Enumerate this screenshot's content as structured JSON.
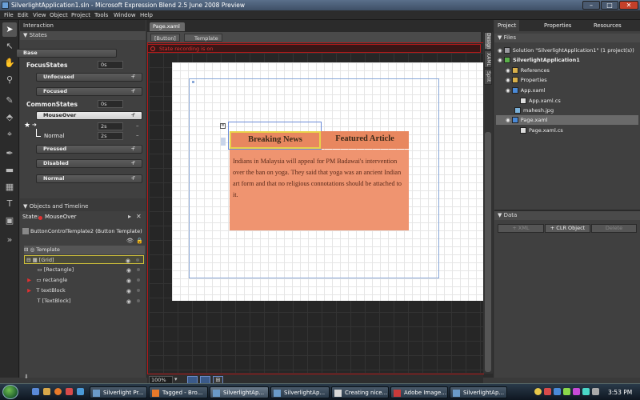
{
  "window": {
    "title": "SilverlightApplication1.sln - Microsoft Expression Blend 2.5 June 2008 Preview",
    "minimize": "–",
    "maximize": "□",
    "close": "✕"
  },
  "menu": [
    "File",
    "Edit",
    "View",
    "Object",
    "Project",
    "Tools",
    "Window",
    "Help"
  ],
  "interaction": {
    "title": "Interaction",
    "states_header": "States",
    "base_label": "Base",
    "focus_group": "FocusStates",
    "focus_time": "0s",
    "unfocused": "Unfocused",
    "focused": "Focused",
    "common_group": "CommonStates",
    "common_time": "0s",
    "mouseover": "MouseOver",
    "transition_time_1": "2s",
    "normal_transition": "Normal",
    "transition_time_2": "2s",
    "star": "★",
    "pressed": "Pressed",
    "disabled": "Disabled",
    "normal": "Normal"
  },
  "objects": {
    "title": "Objects and Timeline",
    "state_label": "State:",
    "state_value": "MouseOver",
    "template_name": "ButtonControlTemplate2 (Button Template)",
    "template": "Template",
    "layers": [
      "[Grid]",
      "[Rectangle]",
      "rectangle",
      "textBlock",
      "[TextBlock]"
    ]
  },
  "document": {
    "tab": "Page.xaml",
    "crumb_button": "[Button]",
    "crumb_template": "Template",
    "recording": "State recording is on",
    "vtabs": [
      "Design",
      "XAML",
      "Split"
    ],
    "zoom": "100%"
  },
  "artboard": {
    "tab1": "Breaking News",
    "tab2": "Featured Article",
    "article": "Indians in Malaysia will appeal for PM Badawai's intervention over the ban on yoga. They said that yoga was an ancient Indian art form and that no religious connotations should be attached to it."
  },
  "project": {
    "tabs": [
      "Project",
      "Properties",
      "Resources"
    ],
    "files_header": "Files",
    "tree": [
      "Solution \"SilverlightApplication1\" (1 project(s))",
      "SilverlightApplication1",
      "References",
      "Properties",
      "App.xaml",
      "App.xaml.cs",
      "mahesh.jpg",
      "Page.xaml",
      "Page.xaml.cs"
    ]
  },
  "data": {
    "title": "Data",
    "xml_btn": "+ XML",
    "clr_btn": "+ CLR Object",
    "delete_btn": "Delete"
  },
  "taskbar": {
    "tasks": [
      "Silverlight Pr...",
      "Tagged - Bro...",
      "SilverlightAp...",
      "SilverlightAp...",
      "Creating nice...",
      "Adobe Image...",
      "SilverlightAp..."
    ],
    "clock": "3:53 PM"
  }
}
